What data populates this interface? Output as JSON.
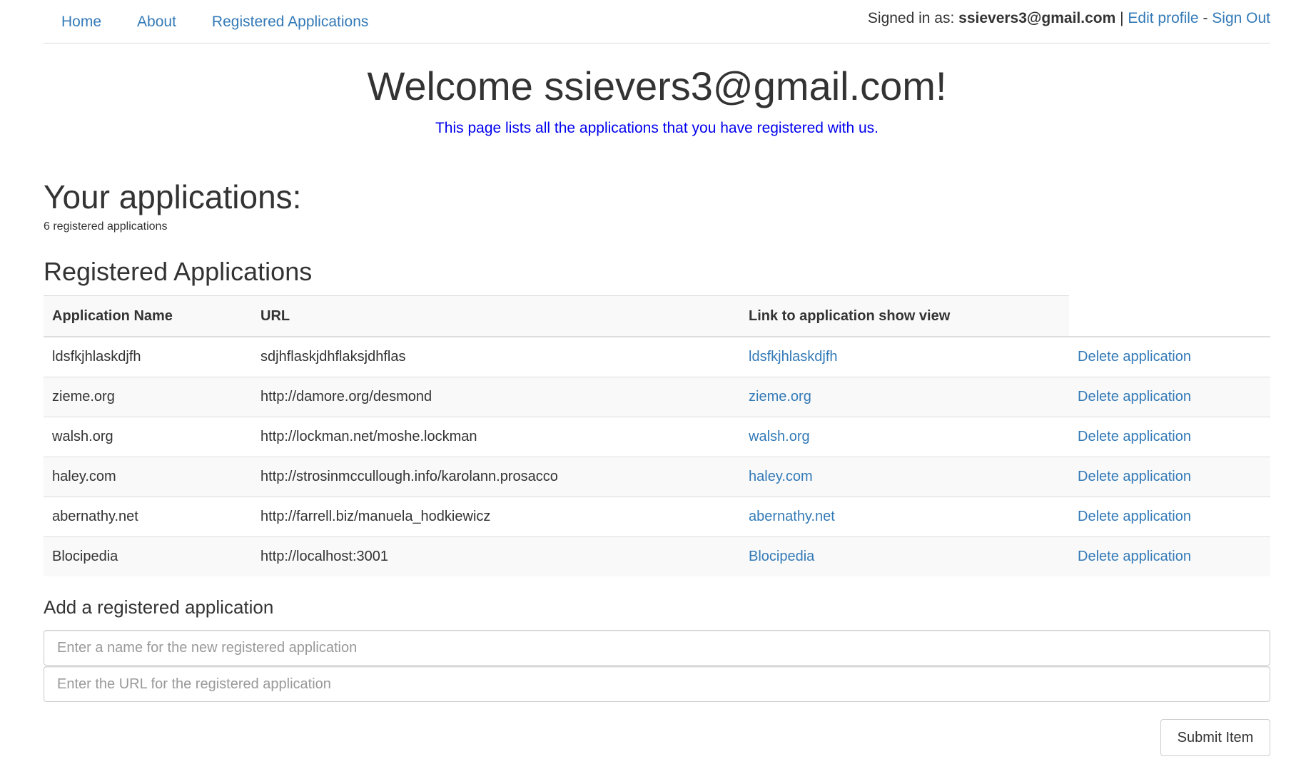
{
  "nav": {
    "links": [
      {
        "label": "Home"
      },
      {
        "label": "About"
      },
      {
        "label": "Registered Applications"
      }
    ],
    "signed_in_prefix": "Signed in as: ",
    "user_email": "ssievers3@gmail.com",
    "separator1": " | ",
    "edit_profile": "Edit profile",
    "separator2": " - ",
    "sign_out": "Sign Out"
  },
  "welcome": "Welcome ssievers3@gmail.com!",
  "intro": "This page lists all the applications that you have registered with us.",
  "your_apps_title": "Your applications:",
  "count_text": "6 registered applications",
  "registered_title": "Registered Applications",
  "table": {
    "headers": [
      "Application Name",
      "URL",
      "Link to application show view"
    ],
    "delete_label": "Delete application",
    "rows": [
      {
        "name": "ldsfkjhlaskdjfh",
        "url": "sdjhflaskjdhflaksjdhflas",
        "link": "ldsfkjhlaskdjfh"
      },
      {
        "name": "zieme.org",
        "url": "http://damore.org/desmond",
        "link": "zieme.org"
      },
      {
        "name": "walsh.org",
        "url": "http://lockman.net/moshe.lockman",
        "link": "walsh.org"
      },
      {
        "name": "haley.com",
        "url": "http://strosinmccullough.info/karolann.prosacco",
        "link": "haley.com"
      },
      {
        "name": "abernathy.net",
        "url": "http://farrell.biz/manuela_hodkiewicz",
        "link": "abernathy.net"
      },
      {
        "name": "Blocipedia",
        "url": "http://localhost:3001",
        "link": "Blocipedia"
      }
    ]
  },
  "form": {
    "title": "Add a registered application",
    "name_placeholder": "Enter a name for the new registered application",
    "url_placeholder": "Enter the URL for the registered application",
    "submit_label": "Submit Item"
  },
  "colors": {
    "link": "#337ab7",
    "intro": "#0000ee",
    "text": "#333333",
    "stripe": "#f9f9f9",
    "border": "#dddddd"
  }
}
